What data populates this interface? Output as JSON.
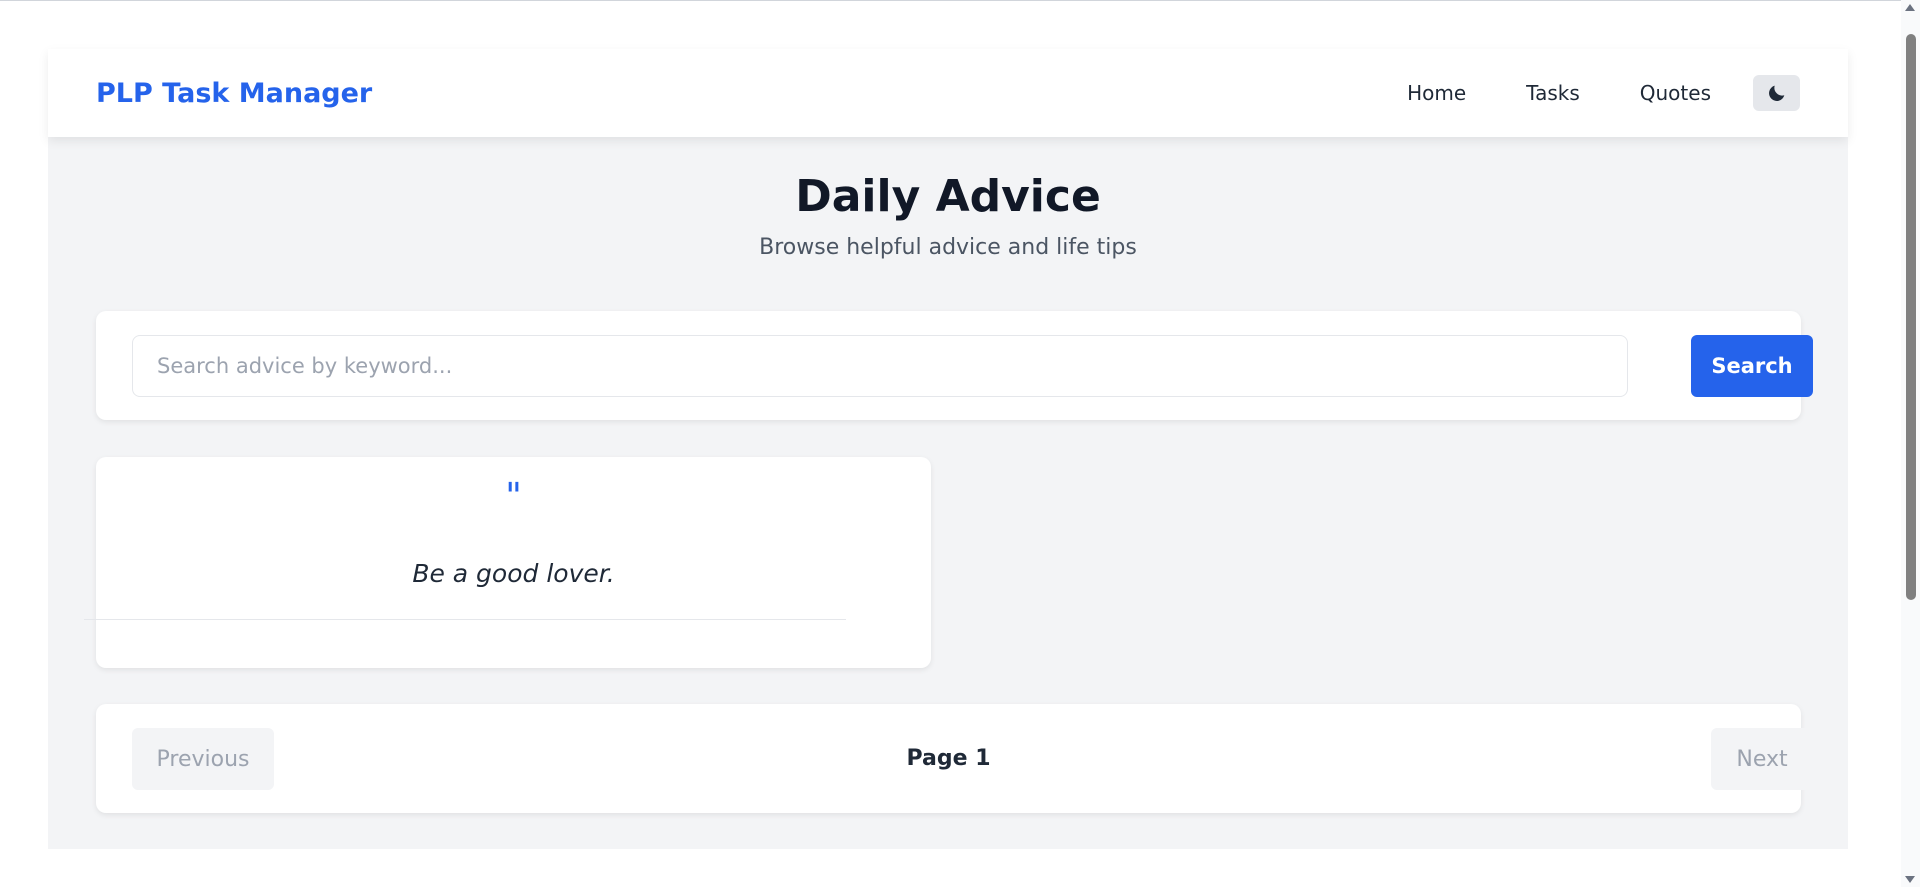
{
  "navbar": {
    "brand": "PLP Task Manager",
    "links": [
      {
        "label": "Home"
      },
      {
        "label": "Tasks"
      },
      {
        "label": "Quotes"
      }
    ],
    "theme_toggle_icon": "moon-icon"
  },
  "header": {
    "title": "Daily Advice",
    "subtitle": "Browse helpful advice and life tips"
  },
  "search": {
    "placeholder": "Search advice by keyword...",
    "value": "",
    "button_label": "Search"
  },
  "advice": [
    {
      "quote_mark": "\"",
      "text": "Be a good lover."
    }
  ],
  "pagination": {
    "previous_label": "Previous",
    "page_label": "Page 1",
    "next_label": "Next"
  },
  "colors": {
    "accent": "#2563eb",
    "background": "#f3f4f6",
    "card": "#ffffff"
  }
}
